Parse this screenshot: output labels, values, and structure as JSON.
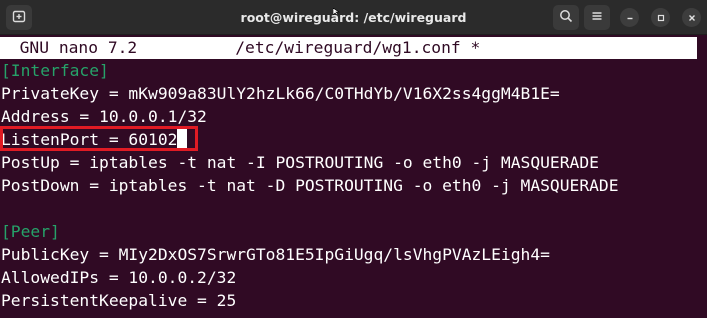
{
  "window": {
    "title": "root@wireguard: /etc/wireguard"
  },
  "icons": {
    "new_tab": "new-tab-icon",
    "search": "search-icon",
    "menu": "hamburger-menu-icon",
    "minimize": "minimize-icon",
    "maximize": "maximize-icon",
    "close": "close-icon"
  },
  "colors": {
    "terminal_bg": "#300a24",
    "section_header": "#26a269",
    "highlight_border": "#e01b24"
  },
  "nano": {
    "header": "  GNU nano 7.2          /etc/wireguard/wg1.conf *"
  },
  "file_lines": [
    "[Interface]",
    "PrivateKey = mKw909a83UlY2hzLk66/C0THdYb/V16X2ss4ggM4B1E=",
    "Address = 10.0.0.1/32",
    "ListenPort = 60102",
    "PostUp = iptables -t nat -I POSTROUTING -o eth0 -j MASQUERADE",
    "PostDown = iptables -t nat -D POSTROUTING -o eth0 -j MASQUERADE",
    "",
    "[Peer]",
    "PublicKey = MIy2DxOS7SrwrGTo81E5IpGiUgq/lsVhgPVAzLEigh4=",
    "AllowedIPs = 10.0.0.2/32",
    "PersistentKeepalive = 25"
  ]
}
